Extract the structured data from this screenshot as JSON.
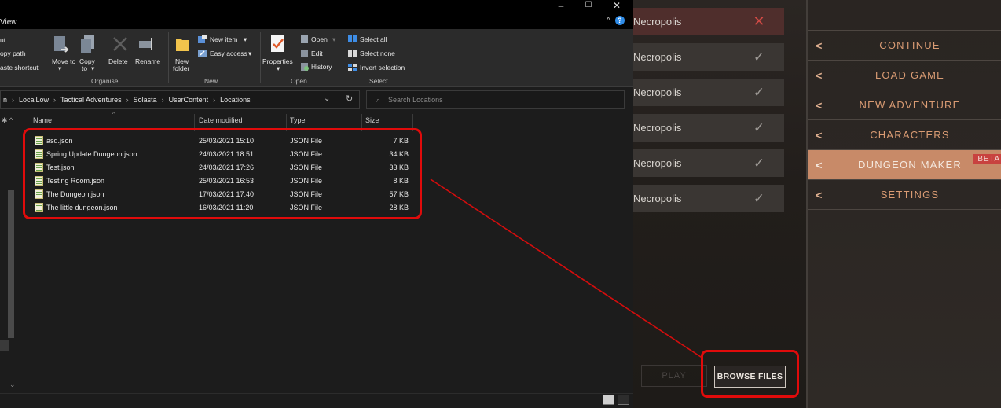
{
  "game": {
    "locations": [
      {
        "name": "Necropolis",
        "status": "✕"
      },
      {
        "name": "Necropolis",
        "status": "✓"
      },
      {
        "name": "Necropolis",
        "status": "✓"
      },
      {
        "name": "Necropolis",
        "status": "✓"
      },
      {
        "name": "Necropolis",
        "status": "✓"
      },
      {
        "name": "Necropolis",
        "status": "✓"
      }
    ],
    "play_label": "PLAY",
    "browse_label": "BROWSE FILES",
    "menu": [
      {
        "label": "CONTINUE"
      },
      {
        "label": "LOAD GAME"
      },
      {
        "label": "NEW ADVENTURE"
      },
      {
        "label": "CHARACTERS"
      },
      {
        "label": "DUNGEON MAKER"
      },
      {
        "label": "SETTINGS"
      }
    ],
    "beta_badge": "BETA",
    "chevron": "<",
    "accent_color": "#c88a68",
    "highlight_color": "#e00b0b"
  },
  "explorer": {
    "title_fragment": "View",
    "window_controls": {
      "minimize": "–",
      "maximize": "☐",
      "close": "✕"
    },
    "help_glyphs": {
      "collapse": "^",
      "help": "?"
    },
    "ribbon": {
      "clipboard_items": [
        "ut",
        "opy path",
        "aste shortcut"
      ],
      "organise": {
        "move_to": "Move to",
        "move_to_arrow": "▾",
        "copy_to": "Copy",
        "copy_to_sub": "to",
        "copy_to_arrow": "▾",
        "delete": "Delete",
        "rename": "Rename",
        "group": "Organise"
      },
      "new": {
        "new_item": "New item",
        "easy_access": "Easy access",
        "new_folder_1": "New",
        "new_folder_2": "folder",
        "group": "New"
      },
      "open": {
        "properties": "Properties",
        "open": "Open",
        "edit": "Edit",
        "history": "History",
        "group": "Open"
      },
      "select": {
        "select_all": "Select all",
        "select_none": "Select none",
        "invert": "Invert selection",
        "group": "Select"
      },
      "dropdown_arrow": "▾"
    },
    "address": {
      "crumbs": [
        "n",
        "LocalLow",
        "Tactical Adventures",
        "Solasta",
        "UserContent",
        "Locations"
      ],
      "separator": "›",
      "dropdown": "⌄",
      "refresh": "↻"
    },
    "search": {
      "placeholder": "Search Locations",
      "icon": "⌕"
    },
    "columns": {
      "name": "Name",
      "date": "Date modified",
      "type": "Type",
      "size": "Size",
      "sort_arrow": "^"
    },
    "pin_glyph": "✱ ^",
    "files": [
      {
        "name": "asd.json",
        "date": "25/03/2021 15:10",
        "type": "JSON File",
        "size": "7 KB"
      },
      {
        "name": "Spring Update Dungeon.json",
        "date": "24/03/2021 18:51",
        "type": "JSON File",
        "size": "34 KB"
      },
      {
        "name": "Test.json",
        "date": "24/03/2021 17:26",
        "type": "JSON File",
        "size": "33 KB"
      },
      {
        "name": "Testing Room.json",
        "date": "25/03/2021 16:53",
        "type": "JSON File",
        "size": "8 KB"
      },
      {
        "name": "The Dungeon.json",
        "date": "17/03/2021 17:40",
        "type": "JSON File",
        "size": "57 KB"
      },
      {
        "name": "The little dungeon.json",
        "date": "16/03/2021 11:20",
        "type": "JSON File",
        "size": "28 KB"
      }
    ],
    "nav_scroll_down": "⌄"
  }
}
